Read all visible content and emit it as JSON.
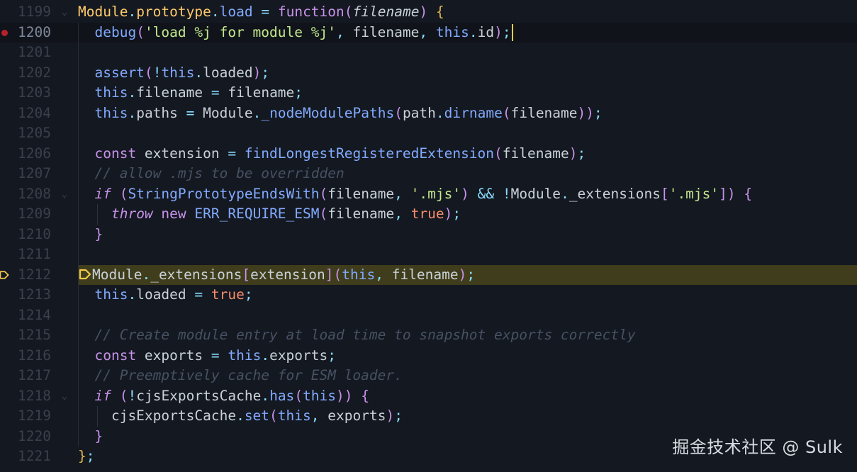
{
  "editor": {
    "language": "javascript",
    "breakpoint_line": "1200",
    "paused_line": "1212",
    "lines": [
      {
        "num": "1199",
        "fold": true,
        "tokens": [
          [
            "yellow",
            "Module"
          ],
          [
            "punc",
            "."
          ],
          [
            "yellow",
            "prototype"
          ],
          [
            "punc",
            "."
          ],
          [
            "fn",
            "load"
          ],
          [
            "ident",
            " "
          ],
          [
            "op",
            "="
          ],
          [
            "ident",
            " "
          ],
          [
            "kw",
            "function"
          ],
          [
            "paren",
            "("
          ],
          [
            "param",
            "filename"
          ],
          [
            "paren",
            ")"
          ],
          [
            "ident",
            " "
          ],
          [
            "brace",
            "{"
          ]
        ]
      },
      {
        "num": "1200",
        "breakpoint": true,
        "current": true,
        "tokens": [
          [
            "ident",
            "  "
          ],
          [
            "fn",
            "debug"
          ],
          [
            "paren",
            "("
          ],
          [
            "str",
            "'load %j for module %j'"
          ],
          [
            "punc",
            ","
          ],
          [
            "ident",
            " filename"
          ],
          [
            "punc",
            ","
          ],
          [
            "ident",
            " "
          ],
          [
            "this",
            "this"
          ],
          [
            "punc",
            "."
          ],
          [
            "ident",
            "id"
          ],
          [
            "paren",
            ")"
          ],
          [
            "punc",
            ";"
          ]
        ]
      },
      {
        "num": "1201",
        "tokens": []
      },
      {
        "num": "1202",
        "tokens": [
          [
            "ident",
            "  "
          ],
          [
            "fn",
            "assert"
          ],
          [
            "paren",
            "("
          ],
          [
            "op",
            "!"
          ],
          [
            "this",
            "this"
          ],
          [
            "punc",
            "."
          ],
          [
            "ident",
            "loaded"
          ],
          [
            "paren",
            ")"
          ],
          [
            "punc",
            ";"
          ]
        ]
      },
      {
        "num": "1203",
        "tokens": [
          [
            "ident",
            "  "
          ],
          [
            "this",
            "this"
          ],
          [
            "punc",
            "."
          ],
          [
            "ident",
            "filename "
          ],
          [
            "op",
            "="
          ],
          [
            "ident",
            " filename"
          ],
          [
            "punc",
            ";"
          ]
        ]
      },
      {
        "num": "1204",
        "tokens": [
          [
            "ident",
            "  "
          ],
          [
            "this",
            "this"
          ],
          [
            "punc",
            "."
          ],
          [
            "ident",
            "paths "
          ],
          [
            "op",
            "="
          ],
          [
            "ident",
            " Module"
          ],
          [
            "punc",
            "."
          ],
          [
            "fn",
            "_nodeModulePaths"
          ],
          [
            "paren",
            "("
          ],
          [
            "ident",
            "path"
          ],
          [
            "punc",
            "."
          ],
          [
            "fn",
            "dirname"
          ],
          [
            "paren",
            "("
          ],
          [
            "ident",
            "filename"
          ],
          [
            "paren",
            "))"
          ],
          [
            "punc",
            ";"
          ]
        ]
      },
      {
        "num": "1205",
        "tokens": []
      },
      {
        "num": "1206",
        "tokens": [
          [
            "ident",
            "  "
          ],
          [
            "kw",
            "const"
          ],
          [
            "ident",
            " extension "
          ],
          [
            "op",
            "="
          ],
          [
            "ident",
            " "
          ],
          [
            "fn",
            "findLongestRegisteredExtension"
          ],
          [
            "paren",
            "("
          ],
          [
            "ident",
            "filename"
          ],
          [
            "paren",
            ")"
          ],
          [
            "punc",
            ";"
          ]
        ]
      },
      {
        "num": "1207",
        "tokens": [
          [
            "ident",
            "  "
          ],
          [
            "cmt",
            "// allow .mjs to be overridden"
          ]
        ]
      },
      {
        "num": "1208",
        "fold": true,
        "tokens": [
          [
            "ident",
            "  "
          ],
          [
            "kw-i",
            "if"
          ],
          [
            "ident",
            " "
          ],
          [
            "paren",
            "("
          ],
          [
            "fn",
            "StringPrototypeEndsWith"
          ],
          [
            "paren",
            "("
          ],
          [
            "ident",
            "filename"
          ],
          [
            "punc",
            ","
          ],
          [
            "ident",
            " "
          ],
          [
            "str",
            "'.mjs'"
          ],
          [
            "paren",
            ")"
          ],
          [
            "ident",
            " "
          ],
          [
            "op",
            "&&"
          ],
          [
            "ident",
            " "
          ],
          [
            "op",
            "!"
          ],
          [
            "ident",
            "Module"
          ],
          [
            "punc",
            "."
          ],
          [
            "ident",
            "_extensions"
          ],
          [
            "paren",
            "["
          ],
          [
            "str",
            "'.mjs'"
          ],
          [
            "paren",
            "])"
          ],
          [
            "ident",
            " "
          ],
          [
            "paren",
            "{"
          ]
        ]
      },
      {
        "num": "1209",
        "tokens": [
          [
            "ident",
            "    "
          ],
          [
            "kw-i",
            "throw"
          ],
          [
            "ident",
            " "
          ],
          [
            "kw",
            "new"
          ],
          [
            "ident",
            " "
          ],
          [
            "fn",
            "ERR_REQUIRE_ESM"
          ],
          [
            "paren",
            "("
          ],
          [
            "ident",
            "filename"
          ],
          [
            "punc",
            ","
          ],
          [
            "ident",
            " "
          ],
          [
            "bool",
            "true"
          ],
          [
            "paren",
            ")"
          ],
          [
            "punc",
            ";"
          ]
        ]
      },
      {
        "num": "1210",
        "tokens": [
          [
            "ident",
            "  "
          ],
          [
            "paren",
            "}"
          ]
        ]
      },
      {
        "num": "1211",
        "tokens": []
      },
      {
        "num": "1212",
        "paused": true,
        "tokens": [
          [
            "ident",
            "Module"
          ],
          [
            "punc",
            "."
          ],
          [
            "ident",
            "_extensions"
          ],
          [
            "paren",
            "["
          ],
          [
            "ident",
            "extension"
          ],
          [
            "paren",
            "]("
          ],
          [
            "this",
            "this"
          ],
          [
            "punc",
            ","
          ],
          [
            "ident",
            " filename"
          ],
          [
            "paren",
            ")"
          ],
          [
            "punc",
            ";"
          ]
        ]
      },
      {
        "num": "1213",
        "tokens": [
          [
            "ident",
            "  "
          ],
          [
            "this",
            "this"
          ],
          [
            "punc",
            "."
          ],
          [
            "ident",
            "loaded "
          ],
          [
            "op",
            "="
          ],
          [
            "ident",
            " "
          ],
          [
            "bool",
            "true"
          ],
          [
            "punc",
            ";"
          ]
        ]
      },
      {
        "num": "1214",
        "tokens": []
      },
      {
        "num": "1215",
        "tokens": [
          [
            "ident",
            "  "
          ],
          [
            "cmt",
            "// Create module entry at load time to snapshot exports correctly"
          ]
        ]
      },
      {
        "num": "1216",
        "tokens": [
          [
            "ident",
            "  "
          ],
          [
            "kw",
            "const"
          ],
          [
            "ident",
            " exports "
          ],
          [
            "op",
            "="
          ],
          [
            "ident",
            " "
          ],
          [
            "this",
            "this"
          ],
          [
            "punc",
            "."
          ],
          [
            "ident",
            "exports"
          ],
          [
            "punc",
            ";"
          ]
        ]
      },
      {
        "num": "1217",
        "tokens": [
          [
            "ident",
            "  "
          ],
          [
            "cmt",
            "// Preemptively cache for ESM loader."
          ]
        ]
      },
      {
        "num": "1218",
        "fold": true,
        "tokens": [
          [
            "ident",
            "  "
          ],
          [
            "kw-i",
            "if"
          ],
          [
            "ident",
            " "
          ],
          [
            "paren",
            "("
          ],
          [
            "op",
            "!"
          ],
          [
            "ident",
            "cjsExportsCache"
          ],
          [
            "punc",
            "."
          ],
          [
            "fn",
            "has"
          ],
          [
            "paren",
            "("
          ],
          [
            "this",
            "this"
          ],
          [
            "paren",
            "))"
          ],
          [
            "ident",
            " "
          ],
          [
            "paren",
            "{"
          ]
        ]
      },
      {
        "num": "1219",
        "tokens": [
          [
            "ident",
            "    cjsExportsCache"
          ],
          [
            "punc",
            "."
          ],
          [
            "fn",
            "set"
          ],
          [
            "paren",
            "("
          ],
          [
            "this",
            "this"
          ],
          [
            "punc",
            ","
          ],
          [
            "ident",
            " exports"
          ],
          [
            "paren",
            ")"
          ],
          [
            "punc",
            ";"
          ]
        ]
      },
      {
        "num": "1220",
        "tokens": [
          [
            "ident",
            "  "
          ],
          [
            "paren",
            "}"
          ]
        ]
      },
      {
        "num": "1221",
        "tokens": [
          [
            "brace",
            "}"
          ],
          [
            "punc",
            ";"
          ]
        ]
      }
    ]
  },
  "watermark": "掘金技术社区 @ Sulk",
  "colors": {
    "background": "#141820",
    "current_line": "#10131a",
    "paused_line": "#3f3d1b",
    "breakpoint": "#b7202a",
    "exec_arrow": "#f2c94c"
  }
}
